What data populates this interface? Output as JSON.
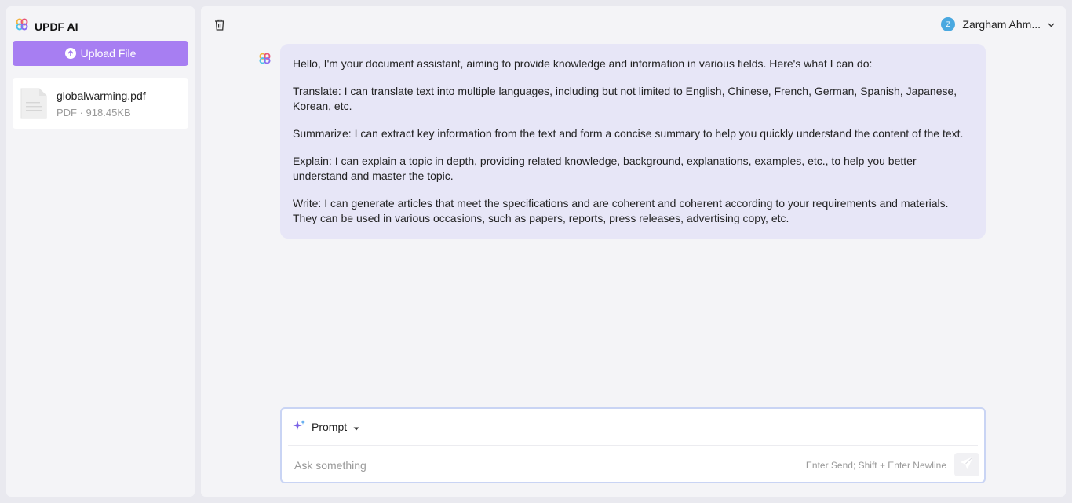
{
  "sidebar": {
    "brand": "UPDF AI",
    "upload_label": "Upload File",
    "files": [
      {
        "name": "globalwarming.pdf",
        "meta": "PDF · 918.45KB"
      }
    ]
  },
  "header": {
    "user_initial": "Z",
    "user_name": "Zargham Ahm..."
  },
  "chat": {
    "messages": [
      "Hello, I'm your document assistant, aiming to provide knowledge and information in various fields. Here's what I can do:",
      "Translate: I can translate text into multiple languages, including but not limited to English, Chinese, French, German, Spanish, Japanese, Korean, etc.",
      "Summarize: I can extract key information from the text and form a concise summary to help you quickly understand the content of the text.",
      "Explain: I can explain a topic in depth, providing related knowledge, background, explanations, examples, etc., to help you better understand and master the topic.",
      "Write: I can generate articles that meet the specifications and are coherent and coherent according to your requirements and materials. They can be used in various occasions, such as papers, reports, press releases, advertising copy, etc."
    ]
  },
  "composer": {
    "prompt_label": "Prompt",
    "placeholder": "Ask something",
    "hint": "Enter Send; Shift + Enter Newline"
  },
  "colors": {
    "accent": "#a77ef2",
    "bubble": "#e7e6f7",
    "avatar": "#49a8e0"
  }
}
